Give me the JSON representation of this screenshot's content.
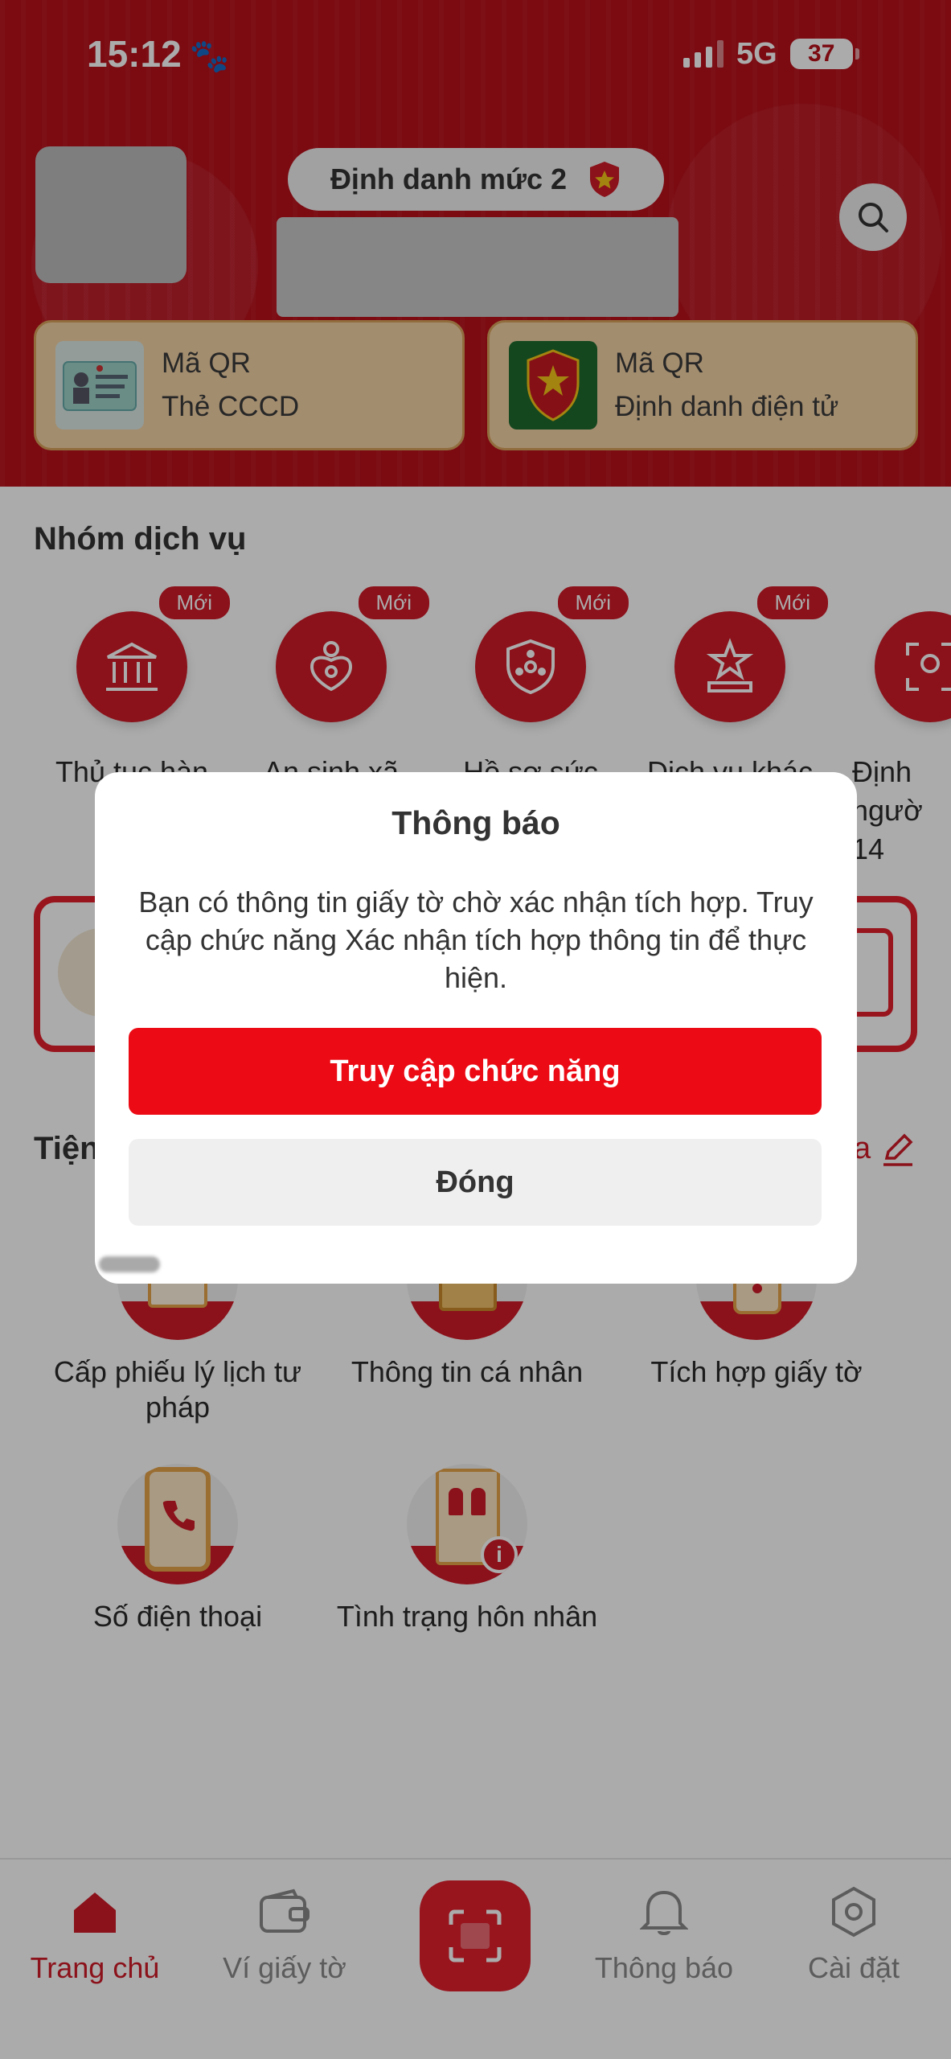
{
  "status_bar": {
    "time": "15:12",
    "network": "5G",
    "battery": "37"
  },
  "header": {
    "id_level": "Định danh mức 2",
    "qr_cards": [
      {
        "line1": "Mã QR",
        "line2": "Thẻ CCCD"
      },
      {
        "line1": "Mã QR",
        "line2": "Định danh điện tử"
      }
    ]
  },
  "services": {
    "title": "Nhóm dịch vụ",
    "new_badge": "Mới",
    "items": [
      {
        "label": "Thủ tục hàn",
        "icon": "bank-icon"
      },
      {
        "label": "An sinh xã",
        "icon": "family-icon"
      },
      {
        "label": "Hồ sơ sức",
        "icon": "health-shield-icon"
      },
      {
        "label": "Dịch vụ khác",
        "icon": "star-podium-icon"
      },
      {
        "label": "Định ngườ 14",
        "icon": "face-scan-icon"
      }
    ]
  },
  "utilities": {
    "title": "Tiện",
    "edit_hint": "a",
    "items": [
      {
        "label": "Cấp phiếu lý lịch tư pháp",
        "icon": "document-icon"
      },
      {
        "label": "Thông tin cá nhân",
        "icon": "profile-book-icon"
      },
      {
        "label": "Tích hợp giấy tờ",
        "icon": "phone-doc-icon"
      },
      {
        "label": "Số điện thoại",
        "icon": "phone-icon"
      },
      {
        "label": "Tình trạng hôn nhân",
        "icon": "marriage-icon"
      }
    ]
  },
  "bottom_nav": {
    "items": [
      {
        "label": "Trang chủ",
        "icon": "home-icon",
        "active": true
      },
      {
        "label": "Ví giấy tờ",
        "icon": "wallet-icon"
      },
      {
        "label": "Thông báo",
        "icon": "bell-icon"
      },
      {
        "label": "Cài đặt",
        "icon": "settings-icon"
      }
    ]
  },
  "dialog": {
    "title": "Thông báo",
    "message": "Bạn có thông tin giấy tờ chờ xác nhận tích hợp. Truy cập chức năng Xác nhận tích hợp thông tin để thực hiện.",
    "primary_button": "Truy cập chức năng",
    "secondary_button": "Đóng"
  },
  "colors": {
    "brand_red": "#d01a27",
    "header_red": "#b80f1a",
    "button_red": "#ec0a14",
    "card_gold": "#f3d3a6"
  }
}
